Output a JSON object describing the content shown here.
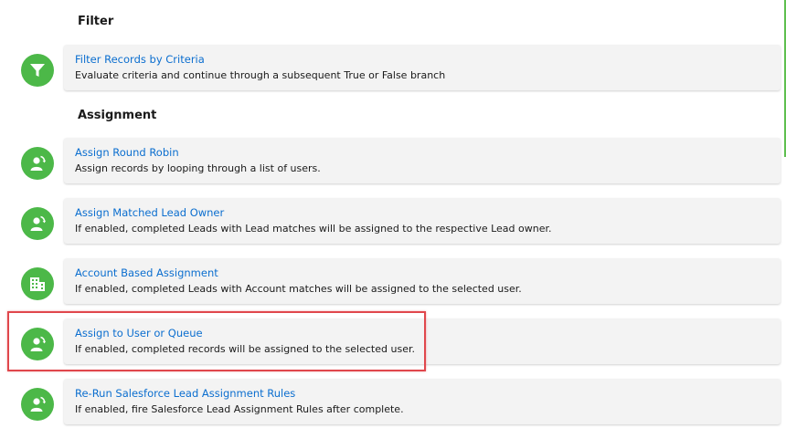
{
  "sections": {
    "filter": "Filter",
    "assignment": "Assignment"
  },
  "items": [
    {
      "title": "Filter Records by Criteria",
      "desc": "Evaluate criteria and continue through a subsequent True or False branch",
      "icon": "filter-icon"
    },
    {
      "title": "Assign Round Robin",
      "desc": "Assign records by looping through a list of users.",
      "icon": "user-assign-icon"
    },
    {
      "title": "Assign Matched Lead Owner",
      "desc": "If enabled, completed Leads with Lead matches will be assigned to the respective Lead owner.",
      "icon": "user-assign-icon"
    },
    {
      "title": "Account Based Assignment",
      "desc": "If enabled, completed Leads with Account matches will be assigned to the selected user.",
      "icon": "building-icon"
    },
    {
      "title": "Assign to User or Queue",
      "desc": "If enabled, completed records will be assigned to the selected user.",
      "icon": "user-assign-icon"
    },
    {
      "title": "Re-Run Salesforce Lead Assignment Rules",
      "desc": "If enabled, fire Salesforce Lead Assignment Rules after complete.",
      "icon": "user-assign-icon"
    }
  ],
  "colors": {
    "icon_bg": "#4cb848",
    "link": "#0b6ecf",
    "highlight": "#e0474c"
  }
}
